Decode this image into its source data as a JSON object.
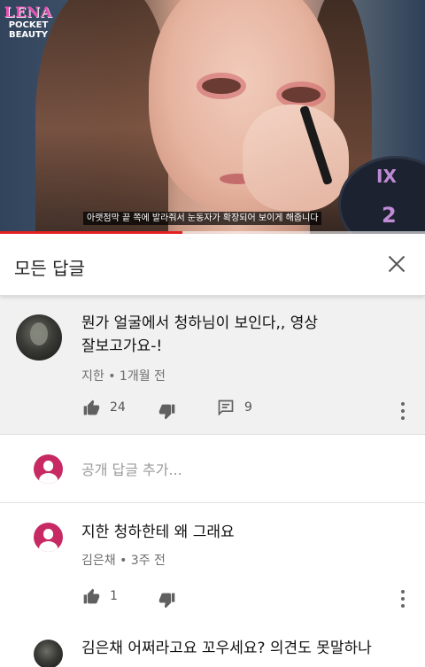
{
  "video": {
    "logo_name": "LENA",
    "logo_sub1": "POCKET",
    "logo_sub2": "BEAUTY",
    "caption": "아랫점막 끝 쪽에 발라줘서 눈동자가 확장되어 보이게 해줍니다",
    "mirror_numerals": [
      "IX",
      "2"
    ],
    "progress": 0.43
  },
  "sheet": {
    "title": "모든 답글"
  },
  "parent_comment": {
    "line1": "뭔가 얼굴에서 청하님이 보인다,, 영상",
    "line2": "잘보고가요-!",
    "meta": "지한 • 1개월 전",
    "likes": "24",
    "replies": "9"
  },
  "composer": {
    "placeholder": "공개 답글 추가..."
  },
  "replies": [
    {
      "text": "지한 청하한테 왜 그래요",
      "meta": "김은채 • 3주 전",
      "likes": "1"
    },
    {
      "text": "김은채 어쩌라고요 꼬우세요? 의견도 못말하나"
    }
  ],
  "colors": {
    "avatar_pink": "#c72a62",
    "progress": "#e52222",
    "parent_bg": "#f1f1f1"
  }
}
